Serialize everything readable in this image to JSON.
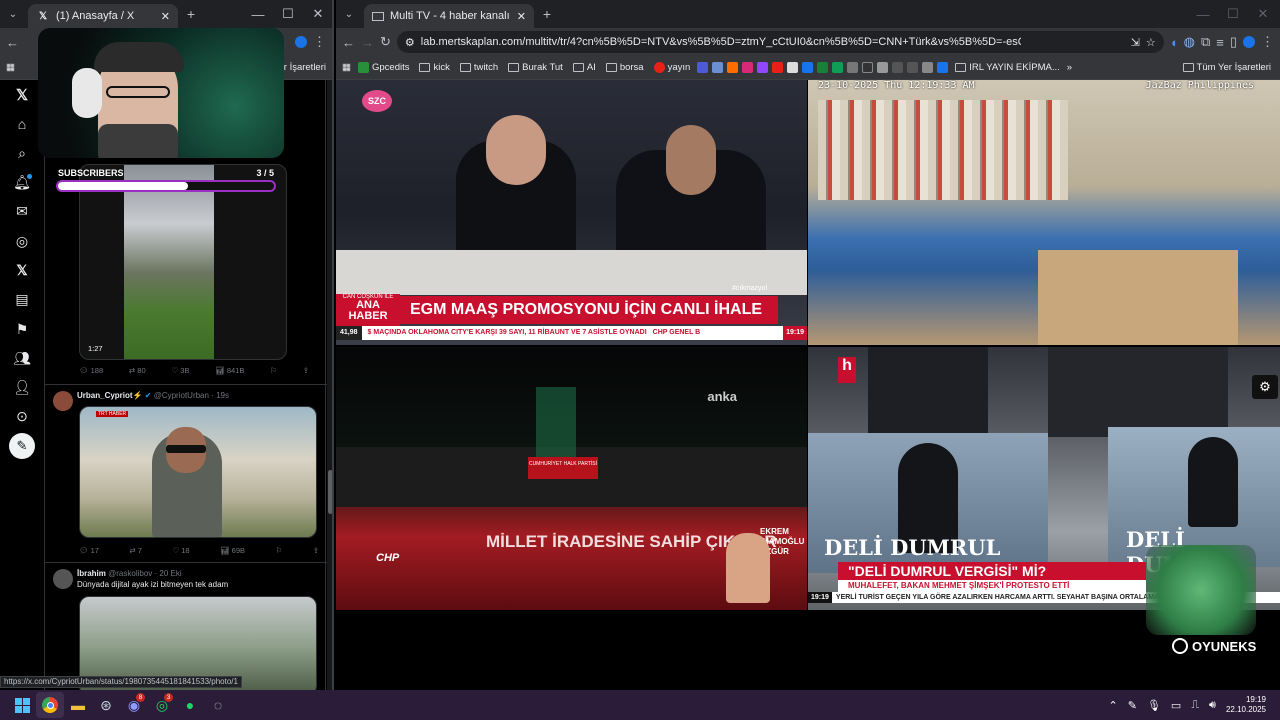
{
  "left_browser": {
    "tab_title": "(1) Anasayfa / X",
    "bookmarks_other": "Yer İşaretleri",
    "status_url": "https://x.com/CypriotUrban/status/1980735445181841533/photo/1"
  },
  "overlay": {
    "subs_label": "SUBSCRIBERS",
    "subs_count": "3 / 5",
    "subs_progress": 0.6
  },
  "x_feed": {
    "post1": {
      "duration": "1:27",
      "replies": "188",
      "reposts": "80",
      "likes": "3B",
      "views": "841B"
    },
    "post2": {
      "name": "Urban_Cypriot",
      "emoji": "⚡",
      "handle": "@CypriotUrban",
      "time": "19s",
      "media_tag": "TRT HABER",
      "replies": "17",
      "reposts": "7",
      "likes": "18",
      "views": "69B"
    },
    "post3": {
      "name": "İbrahim",
      "handle": "@raskolibov",
      "time": "20 Eki",
      "text": "Dünyada dijital ayak izi bitmeyen tek adam"
    }
  },
  "right_browser": {
    "tab_title": "Multi TV - 4 haber kanalını",
    "url": "lab.mertskaplan.com/multitv/tr/4?cn%5B%5D=NTV&vs%5B%5D=ztmY_cCtUI0&cn%5B%5D=CNN+Türk&vs%5B%5D=-esQ-A5ZBCM&cn%5B%5D=...",
    "bookmarks": [
      "Gpcedits",
      "kick",
      "twitch",
      "Burak Tut",
      "AI",
      "borsa",
      "yayın"
    ],
    "bookmark_irl": "IRL YAYIN EKİPMA...",
    "bookmarks_all": "Tüm Yer İşaretleri"
  },
  "video1": {
    "logo": "SZC",
    "tag": "#cıkmazyol",
    "show_top": "CAN COŞKUN İLE",
    "show": "ANA HABER",
    "headline": "EGM MAAŞ PROMOSYONU İÇİN CANLI İHALE",
    "ticker_value": "41,98",
    "ticker": "$ MAÇINDA OKLAHOMA CITY'E KARŞI 39 SAYI, 11 RİBAUNT VE 7 ASİSTLE OYNADI",
    "ticker_tail": "CHP GENEL B",
    "clock": "19:19"
  },
  "video2": {
    "timestamp": "23-10-2025 Thu 12:19:33 AM",
    "channel": "JazBaz Philippines"
  },
  "video3": {
    "logo": "anka",
    "podium": "CUMHURİYET HALK PARTİSİ",
    "banner": "MİLLET İRADESİNE SAHİP ÇIKIYOR",
    "party": "CHP",
    "side1": "EKREM",
    "side2": "İMAMOĞLU",
    "side3": "ÖZGÜR"
  },
  "video4": {
    "logo": "h",
    "poster": "DELİ DUMRUL",
    "poster2": "DELİ DUMRUL",
    "headline": "\"DELİ DUMRUL VERGİSİ\" Mİ?",
    "subhead": "MUHALEFET, BAKAN MEHMET ŞİMŞEK'İ PROTESTO ETTİ",
    "clock": "19:19",
    "ticker": "YERLİ TURİST GEÇEN YILA GÖRE AZALIRKEN HARCAMA ARTTI. SEYAHAT BAŞINA ORTALAMA"
  },
  "brand": "OYUNEKS",
  "taskbar": {
    "time": "19:19",
    "date": "22.10.2025",
    "discord_badge": "8",
    "whatsapp_badge": "3"
  }
}
